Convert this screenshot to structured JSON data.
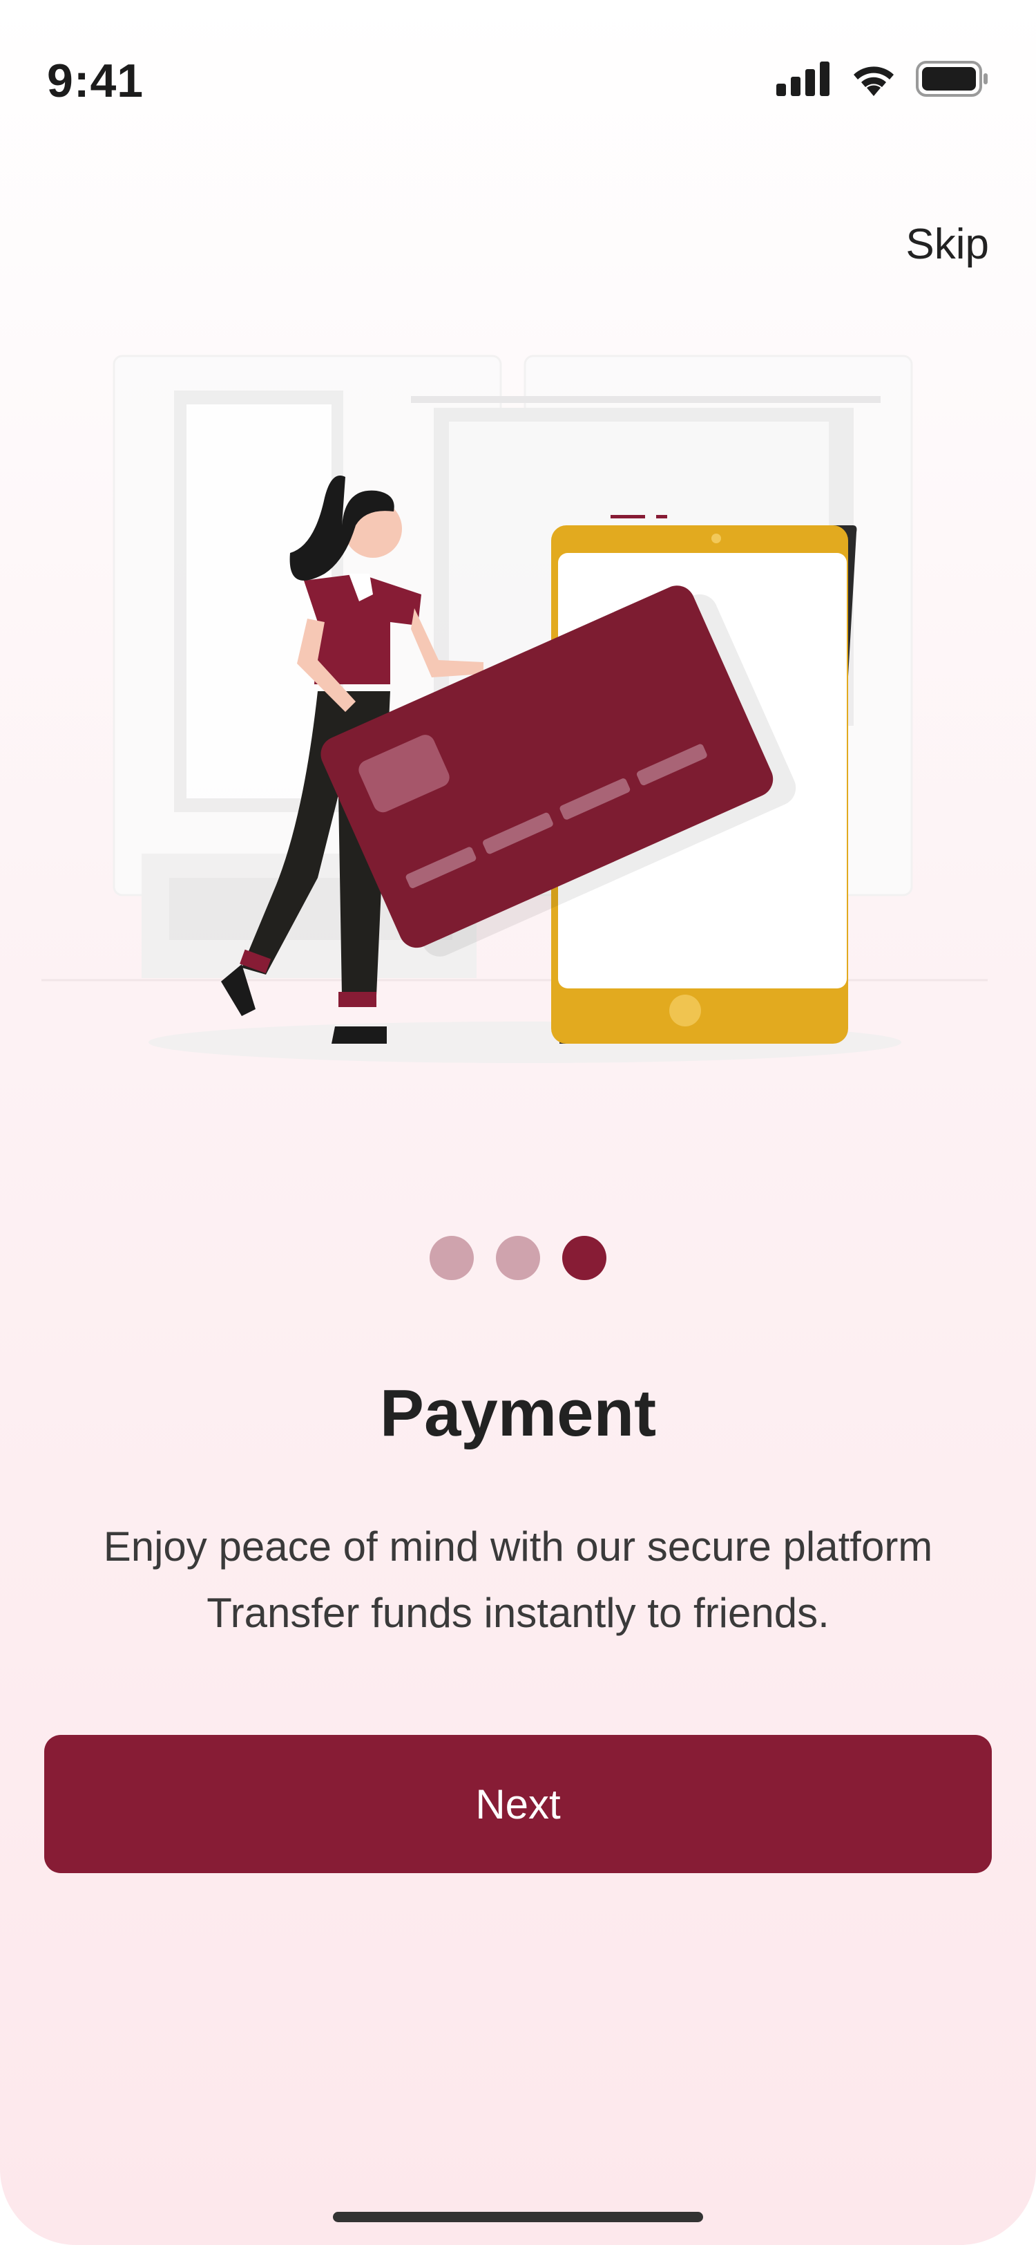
{
  "status_bar": {
    "time": "9:41",
    "icons": [
      "cellular-signal-icon",
      "wifi-icon",
      "battery-icon"
    ]
  },
  "header": {
    "skip_label": "Skip"
  },
  "illustration": {
    "description_icon": "woman-holding-credit-card-phone-illustration"
  },
  "pagination": {
    "total": 3,
    "active_index": 2
  },
  "content": {
    "title": "Payment",
    "body_line1": "Enjoy peace of mind with our secure platform",
    "body_line2": "Transfer funds instantly to friends."
  },
  "actions": {
    "next_label": "Next"
  },
  "colors": {
    "primary": "#871c35",
    "dot_inactive": "#cfa3ad",
    "phone": "#e2aa1f",
    "background_bottom": "#fde8ec"
  }
}
